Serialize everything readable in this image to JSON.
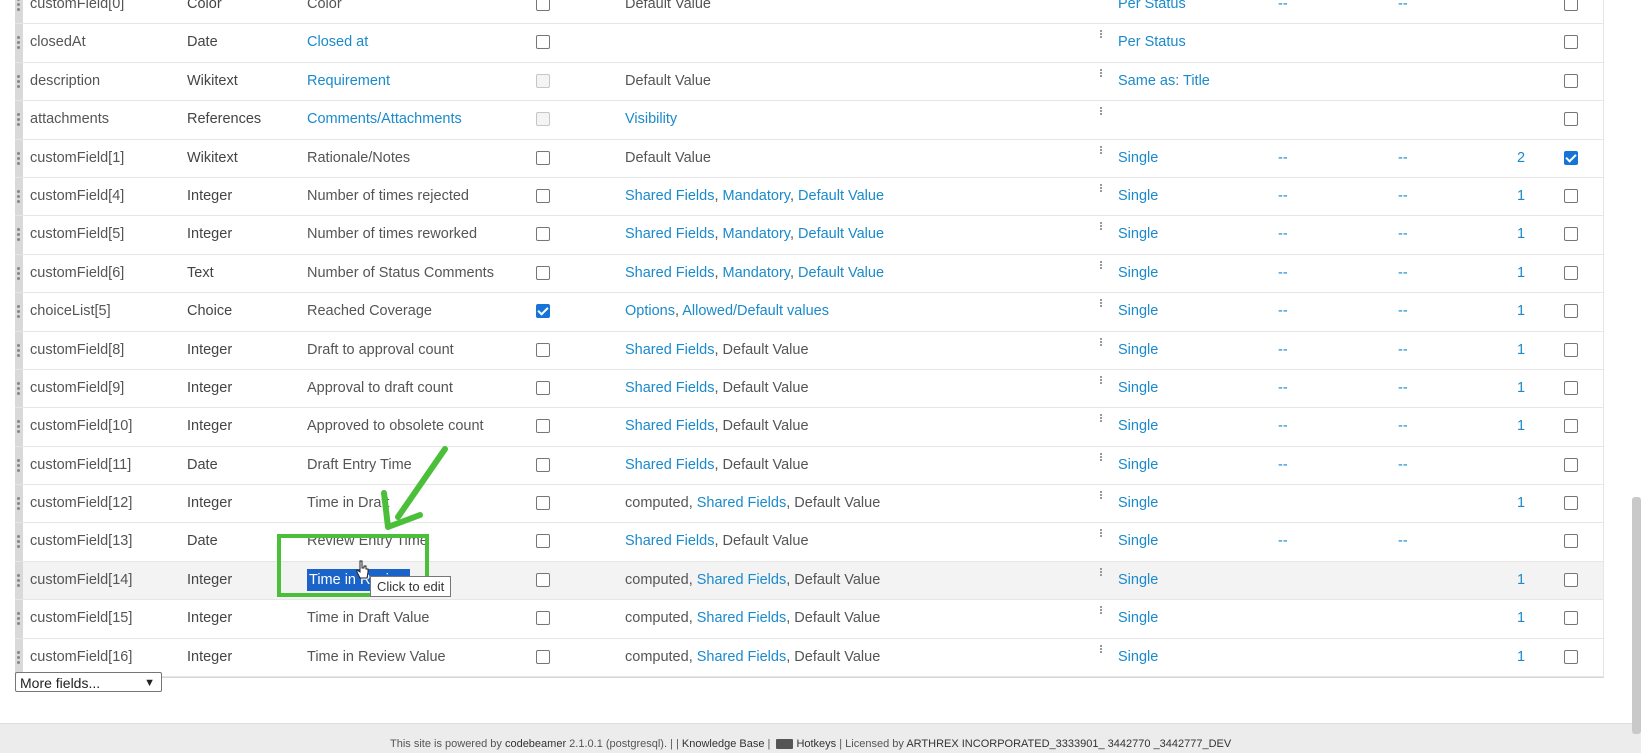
{
  "rows": [
    {
      "prop": "customField[0]",
      "type": "Color",
      "label": "Color",
      "label_link": false,
      "check": "unchecked",
      "opts": [
        {
          "t": "Default Value",
          "l": false
        }
      ],
      "mult": "Per Status",
      "d1": "--",
      "d2": "--",
      "num": "",
      "last": false
    },
    {
      "prop": "closedAt",
      "type": "Date",
      "label": "Closed at",
      "label_link": true,
      "check": "unchecked",
      "opts": [],
      "mult": "Per Status",
      "d1": "",
      "d2": "",
      "num": "",
      "last": false
    },
    {
      "prop": "description",
      "type": "Wikitext",
      "label": "Requirement",
      "label_link": true,
      "check": "disabled",
      "opts": [
        {
          "t": "Default Value",
          "l": false
        }
      ],
      "mult": "Same as: Title",
      "d1": "",
      "d2": "",
      "num": "",
      "last": false
    },
    {
      "prop": "attachments",
      "type": "References",
      "label": "Comments/Attachments",
      "label_link": true,
      "check": "disabled",
      "opts": [
        {
          "t": "Visibility",
          "l": true
        }
      ],
      "mult": "",
      "d1": "",
      "d2": "",
      "num": "",
      "last": false
    },
    {
      "prop": "customField[1]",
      "type": "Wikitext",
      "label": "Rationale/Notes",
      "label_link": false,
      "check": "unchecked",
      "opts": [
        {
          "t": "Default Value",
          "l": false
        }
      ],
      "mult": "Single",
      "d1": "--",
      "d2": "--",
      "num": "2",
      "last": true
    },
    {
      "prop": "customField[4]",
      "type": "Integer",
      "label": "Number of times rejected",
      "label_link": false,
      "check": "unchecked",
      "opts": [
        {
          "t": "Shared Fields",
          "l": true
        },
        {
          "t": "Mandatory",
          "l": true
        },
        {
          "t": "Default Value",
          "l": true
        }
      ],
      "mult": "Single",
      "d1": "--",
      "d2": "--",
      "num": "1",
      "last": false
    },
    {
      "prop": "customField[5]",
      "type": "Integer",
      "label": "Number of times reworked",
      "label_link": false,
      "check": "unchecked",
      "opts": [
        {
          "t": "Shared Fields",
          "l": true
        },
        {
          "t": "Mandatory",
          "l": true
        },
        {
          "t": "Default Value",
          "l": true
        }
      ],
      "mult": "Single",
      "d1": "--",
      "d2": "--",
      "num": "1",
      "last": false
    },
    {
      "prop": "customField[6]",
      "type": "Text",
      "label": "Number of Status Comments",
      "label_link": false,
      "check": "unchecked",
      "opts": [
        {
          "t": "Shared Fields",
          "l": true
        },
        {
          "t": "Mandatory",
          "l": true
        },
        {
          "t": "Default Value",
          "l": true
        }
      ],
      "mult": "Single",
      "d1": "--",
      "d2": "--",
      "num": "1",
      "last": false
    },
    {
      "prop": "choiceList[5]",
      "type": "Choice",
      "label": "Reached Coverage",
      "label_link": false,
      "check": "checked",
      "opts": [
        {
          "t": "Options",
          "l": true
        },
        {
          "t": "Allowed/Default values",
          "l": true
        }
      ],
      "mult": "Single",
      "d1": "--",
      "d2": "--",
      "num": "1",
      "last": false
    },
    {
      "prop": "customField[8]",
      "type": "Integer",
      "label": "Draft to approval count",
      "label_link": false,
      "check": "unchecked",
      "opts": [
        {
          "t": "Shared Fields",
          "l": true
        },
        {
          "t": "Default Value",
          "l": false
        }
      ],
      "mult": "Single",
      "d1": "--",
      "d2": "--",
      "num": "1",
      "last": false
    },
    {
      "prop": "customField[9]",
      "type": "Integer",
      "label": "Approval to draft count",
      "label_link": false,
      "check": "unchecked",
      "opts": [
        {
          "t": "Shared Fields",
          "l": true
        },
        {
          "t": "Default Value",
          "l": false
        }
      ],
      "mult": "Single",
      "d1": "--",
      "d2": "--",
      "num": "1",
      "last": false
    },
    {
      "prop": "customField[10]",
      "type": "Integer",
      "label": "Approved to obsolete count",
      "label_link": false,
      "check": "unchecked",
      "opts": [
        {
          "t": "Shared Fields",
          "l": true
        },
        {
          "t": "Default Value",
          "l": false
        }
      ],
      "mult": "Single",
      "d1": "--",
      "d2": "--",
      "num": "1",
      "last": false
    },
    {
      "prop": "customField[11]",
      "type": "Date",
      "label": "Draft Entry Time",
      "label_link": false,
      "check": "unchecked",
      "opts": [
        {
          "t": "Shared Fields",
          "l": true
        },
        {
          "t": "Default Value",
          "l": false
        }
      ],
      "mult": "Single",
      "d1": "--",
      "d2": "--",
      "num": "",
      "last": false
    },
    {
      "prop": "customField[12]",
      "type": "Integer",
      "label": "Time in Draft",
      "label_link": false,
      "check": "unchecked",
      "opts": [
        {
          "t": "computed",
          "l": false
        },
        {
          "t": "Shared Fields",
          "l": true
        },
        {
          "t": "Default Value",
          "l": false
        }
      ],
      "mult": "Single",
      "d1": "",
      "d2": "",
      "num": "1",
      "last": false
    },
    {
      "prop": "customField[13]",
      "type": "Date",
      "label": "Review Entry Time",
      "label_link": false,
      "check": "unchecked",
      "opts": [
        {
          "t": "Shared Fields",
          "l": true
        },
        {
          "t": "Default Value",
          "l": false
        }
      ],
      "mult": "Single",
      "d1": "--",
      "d2": "--",
      "num": "",
      "last": false
    },
    {
      "prop": "customField[14]",
      "type": "Integer",
      "label": "Time in Review",
      "label_link": true,
      "selected": true,
      "check": "unchecked",
      "opts": [
        {
          "t": "computed",
          "l": false
        },
        {
          "t": "Shared Fields",
          "l": true
        },
        {
          "t": "Default Value",
          "l": false
        }
      ],
      "mult": "Single",
      "d1": "",
      "d2": "",
      "num": "1",
      "last": false
    },
    {
      "prop": "customField[15]",
      "type": "Integer",
      "label": "Time in Draft Value",
      "label_link": false,
      "check": "unchecked",
      "opts": [
        {
          "t": "computed",
          "l": false
        },
        {
          "t": "Shared Fields",
          "l": true
        },
        {
          "t": "Default Value",
          "l": false
        }
      ],
      "mult": "Single",
      "d1": "",
      "d2": "",
      "num": "1",
      "last": false
    },
    {
      "prop": "customField[16]",
      "type": "Integer",
      "label": "Time in Review Value",
      "label_link": false,
      "check": "unchecked",
      "opts": [
        {
          "t": "computed",
          "l": false
        },
        {
          "t": "Shared Fields",
          "l": true
        },
        {
          "t": "Default Value",
          "l": false
        }
      ],
      "mult": "Single",
      "d1": "",
      "d2": "",
      "num": "1",
      "last": false
    }
  ],
  "tooltip": "Click to edit",
  "more_fields": "More fields...",
  "footer": {
    "powered": "This site is powered by",
    "product": "codebeamer",
    "version": "2.1.0.1 (postgresql). | |",
    "kb": "Knowledge Base",
    "sep1": "|",
    "hotkeys": "Hotkeys",
    "licensed": "| Licensed by",
    "licensee": "ARTHREX INCORPORATED_3333901_ 3442770 _3442777_DEV"
  },
  "colors": {
    "link": "#1a8acb",
    "highlight": "#4bbf3a",
    "selection": "#1a63c9"
  }
}
